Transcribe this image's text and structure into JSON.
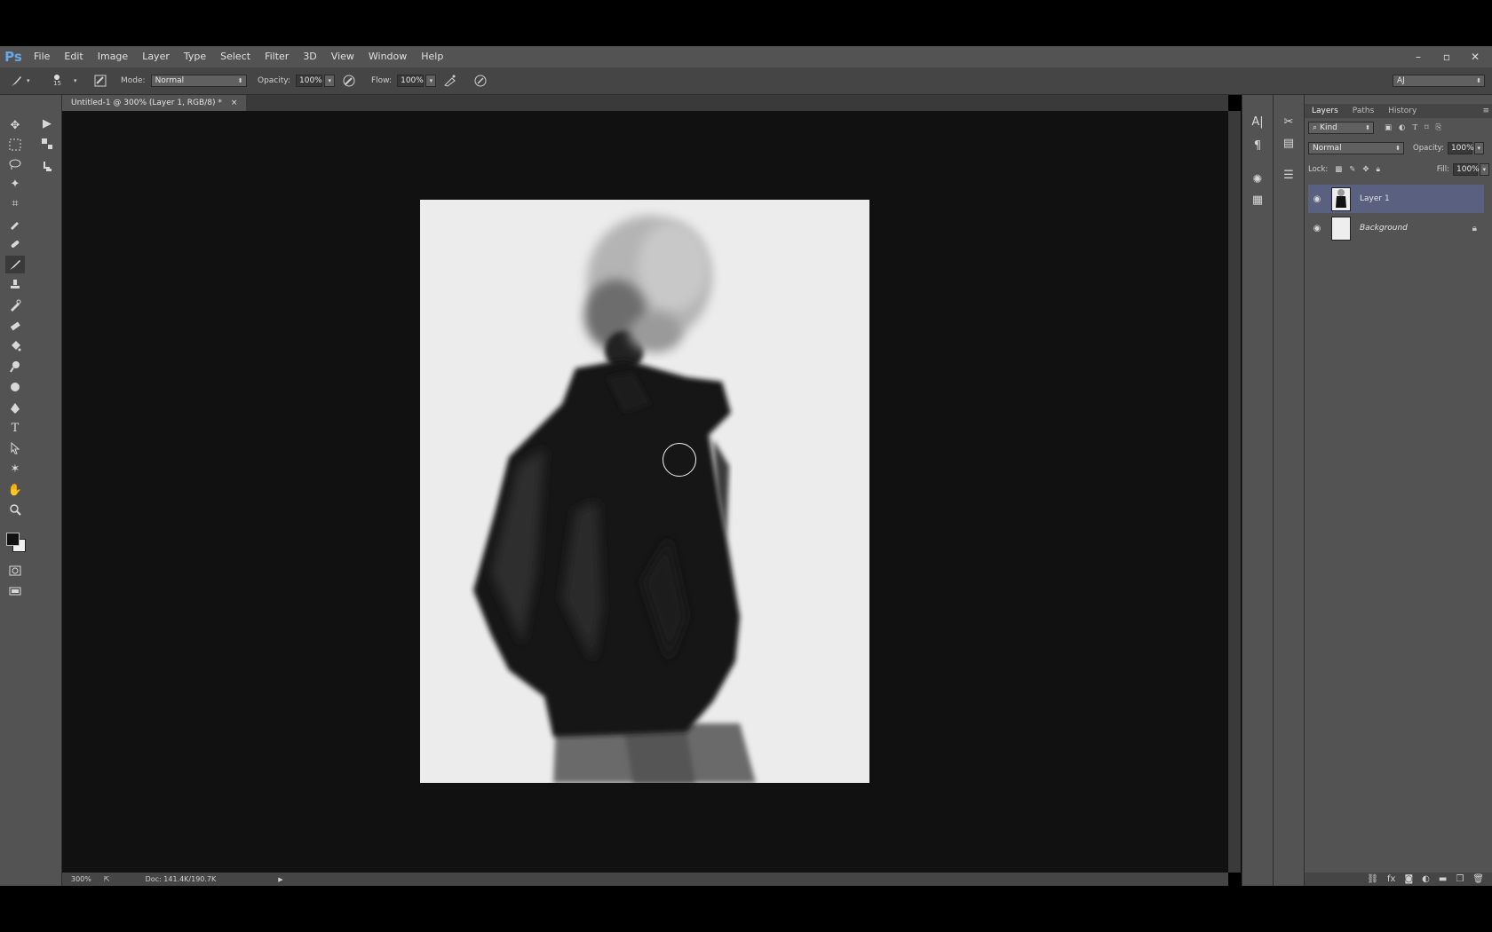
{
  "app": {
    "logo": "Ps"
  },
  "menu": [
    "File",
    "Edit",
    "Image",
    "Layer",
    "Type",
    "Select",
    "Filter",
    "3D",
    "View",
    "Window",
    "Help"
  ],
  "window_controls": {
    "minimize": "–",
    "restore": "▫",
    "close": "✕"
  },
  "options": {
    "brush_size": "15",
    "mode_label": "Mode:",
    "mode_value": "Normal",
    "opacity_label": "Opacity:",
    "opacity_value": "100%",
    "flow_label": "Flow:",
    "flow_value": "100%",
    "workspace": "AJ"
  },
  "document": {
    "tab_title": "Untitled-1 @ 300% (Layer 1, RGB/8) *",
    "tab_close": "×",
    "zoom": "300%",
    "doc_info": "Doc: 141.4K/190.7K"
  },
  "layers_panel": {
    "tabs": [
      "Layers",
      "Paths",
      "History"
    ],
    "filter_kind": "Kind",
    "blend_mode": "Normal",
    "opacity_label": "Opacity:",
    "opacity_value": "100%",
    "lock_label": "Lock:",
    "fill_label": "Fill:",
    "fill_value": "100%",
    "layers": [
      {
        "name": "Layer 1",
        "selected": true
      },
      {
        "name": "Background",
        "selected": false,
        "locked": true
      }
    ]
  },
  "colors": {
    "accent_selected": "#5a6080",
    "canvas_bg": "#111112",
    "paper": "#ececec"
  }
}
